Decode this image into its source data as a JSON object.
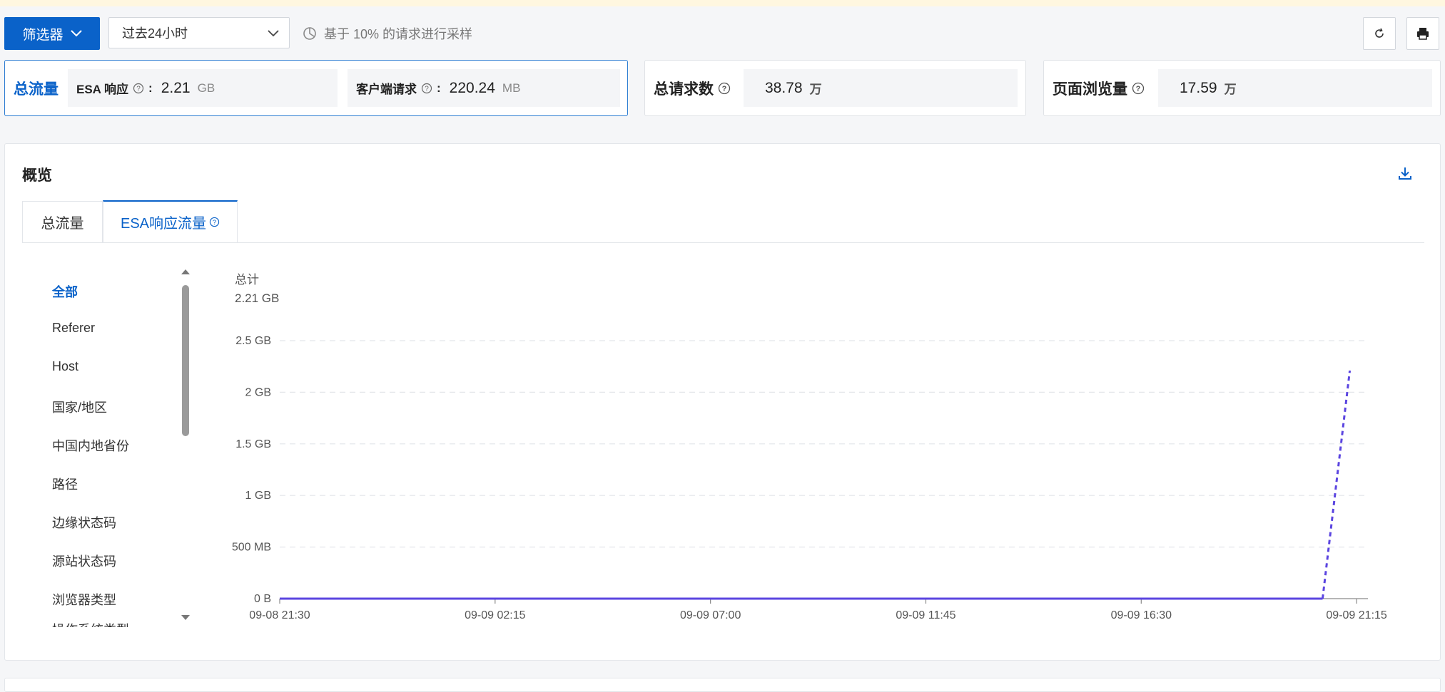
{
  "toolbar": {
    "filter_label": "筛选器",
    "time_range": "过去24小时",
    "sampling_note": "基于 10% 的请求进行采样"
  },
  "cards": {
    "traffic": {
      "title": "总流量",
      "esa_label": "ESA 响应",
      "esa_value": "2.21",
      "esa_unit": "GB",
      "client_label": "客户端请求",
      "client_value": "220.24",
      "client_unit": "MB"
    },
    "requests": {
      "title": "总请求数",
      "value": "38.78",
      "unit": "万"
    },
    "pageviews": {
      "title": "页面浏览量",
      "value": "17.59",
      "unit": "万"
    }
  },
  "overview": {
    "title": "概览",
    "tabs": [
      {
        "label": "总流量"
      },
      {
        "label": "ESA响应流量"
      }
    ],
    "dimensions": [
      "全部",
      "Referer",
      "Host",
      "国家/地区",
      "中国内地省份",
      "路径",
      "边缘状态码",
      "源站状态码",
      "浏览器类型",
      "操作系统类型"
    ],
    "total_label": "总计",
    "total_value": "2.21 GB"
  },
  "colors": {
    "brand": "#0a62c9",
    "series": "#5b45e0"
  },
  "chart_data": {
    "type": "line",
    "ylabels": [
      "0 B",
      "500 MB",
      "1 GB",
      "1.5 GB",
      "2 GB",
      "2.5 GB"
    ],
    "yvalues_gb": [
      0,
      0.5,
      1,
      1.5,
      2,
      2.5
    ],
    "ylim_gb": [
      0,
      2.5
    ],
    "xlabels": [
      "09-08 21:30",
      "09-09 02:15",
      "09-09 07:00",
      "09-09 11:45",
      "09-09 16:30",
      "09-09 21:15"
    ],
    "xlim_hours": [
      0,
      24
    ],
    "xtick_hours": [
      0,
      4.75,
      9.5,
      14.25,
      19,
      23.75
    ],
    "series": [
      {
        "solid": [
          [
            0,
            0
          ],
          [
            23.0,
            0
          ]
        ],
        "dashed": [
          [
            23.0,
            0
          ],
          [
            23.6,
            2.21
          ]
        ]
      }
    ],
    "grid": true,
    "grid_style": "dashed"
  }
}
